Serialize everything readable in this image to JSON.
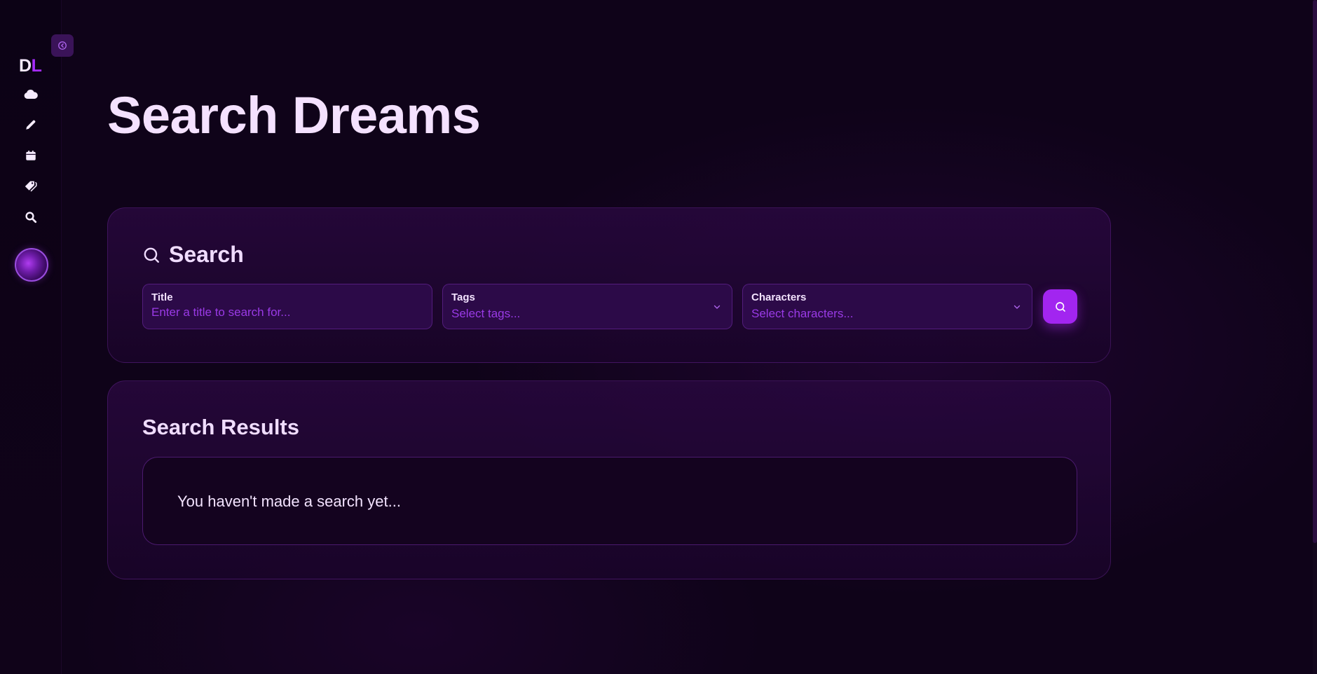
{
  "sidebar": {
    "logo_first": "D",
    "logo_second": "L",
    "icons": [
      "cloud-icon",
      "pencil-icon",
      "calendar-icon",
      "tags-icon",
      "search-icon"
    ]
  },
  "page": {
    "title": "Search Dreams"
  },
  "search": {
    "heading": "Search",
    "title_label": "Title",
    "title_placeholder": "Enter a title to search for...",
    "tags_label": "Tags",
    "tags_placeholder": "Select tags...",
    "characters_label": "Characters",
    "characters_placeholder": "Select characters..."
  },
  "results": {
    "heading": "Search Results",
    "empty_message": "You haven't made a search yet..."
  },
  "colors": {
    "accent": "#a225f0",
    "background": "#0f0319",
    "text": "#f3e3ff"
  }
}
